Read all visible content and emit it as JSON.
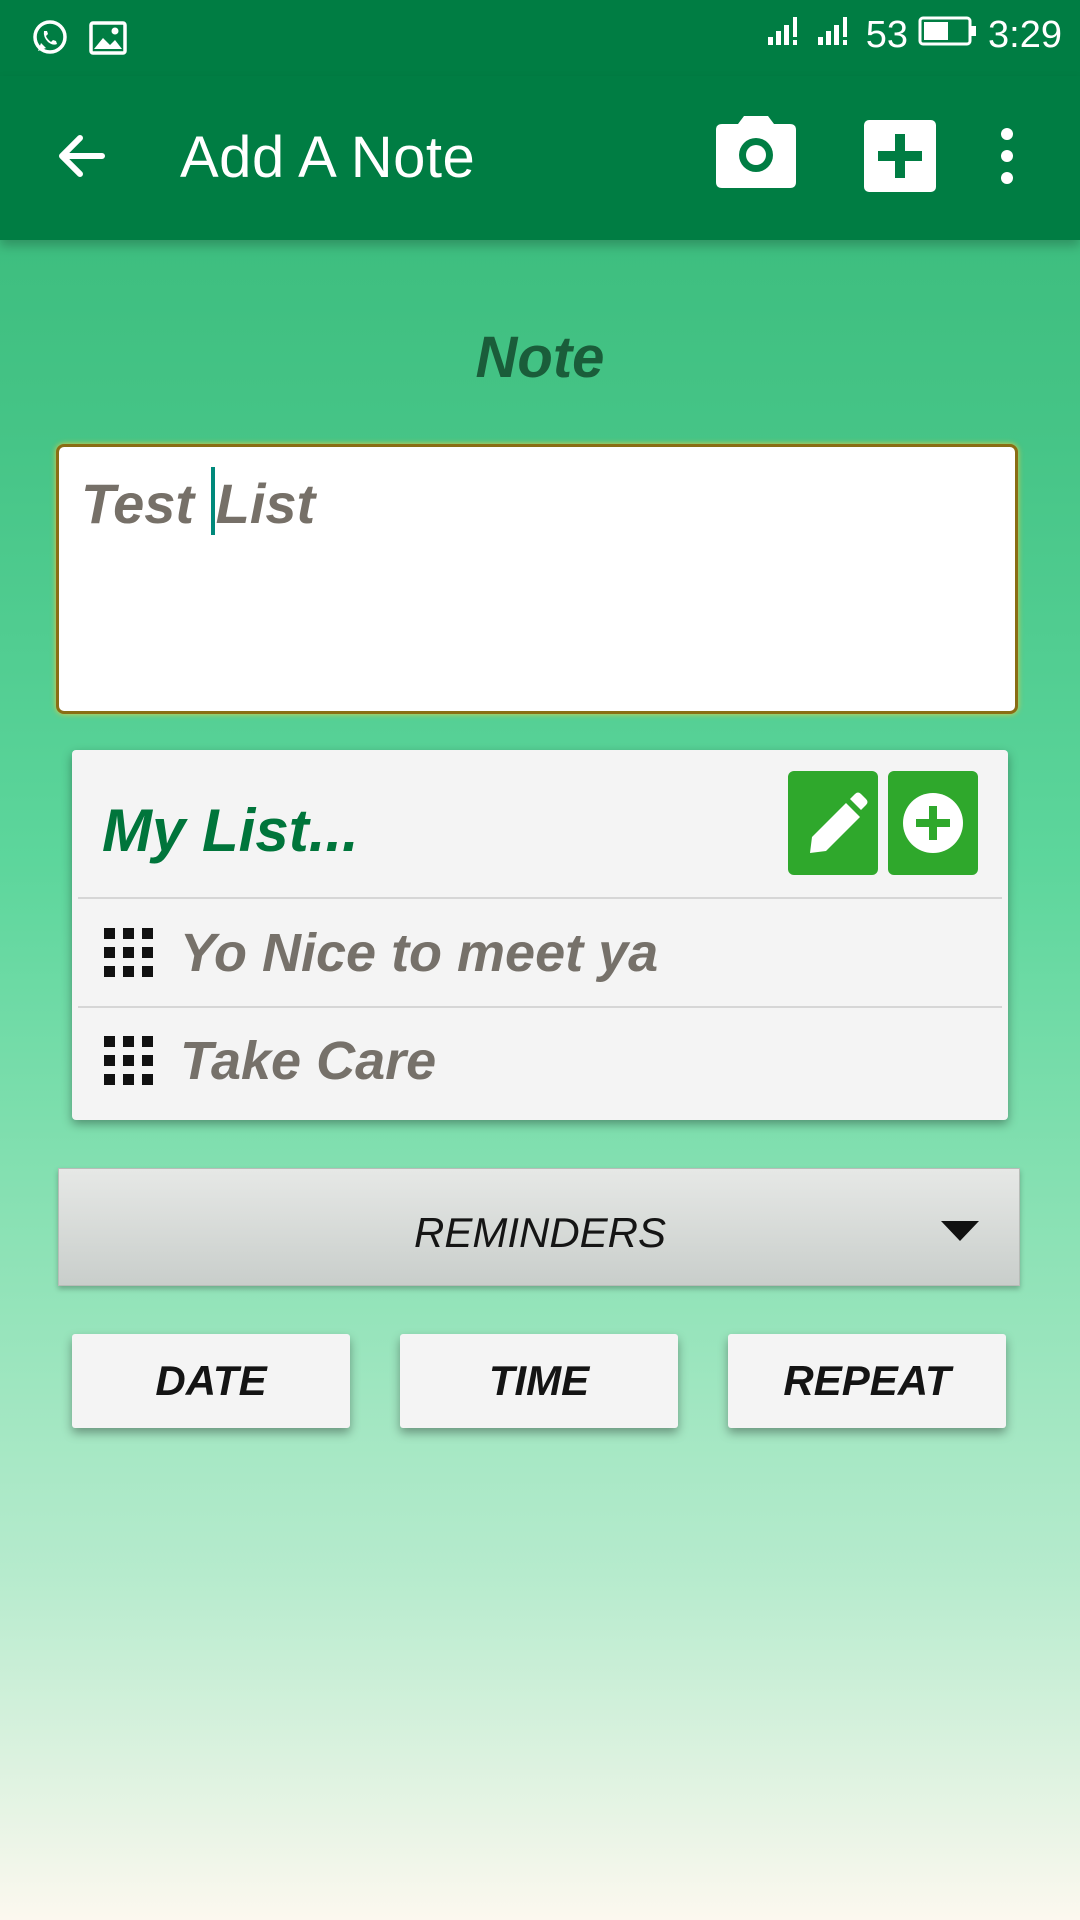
{
  "status_bar": {
    "icons": [
      "whatsapp-icon",
      "image-icon",
      "signal-icon",
      "signal-icon",
      "battery-icon"
    ],
    "battery": "53",
    "time": "3:29"
  },
  "app_bar": {
    "title": "Add A Note",
    "actions": [
      "back-arrow-icon",
      "camera-icon",
      "add-box-icon",
      "more-vert-icon"
    ]
  },
  "note": {
    "heading": "Note",
    "text_before_cursor": "Test ",
    "text_after_cursor": "List"
  },
  "list": {
    "title": "My List...",
    "actions": [
      "pencil-icon",
      "add-circle-icon"
    ],
    "items": [
      {
        "icon": "grid-icon",
        "label": "Yo Nice to meet ya"
      },
      {
        "icon": "grid-icon",
        "label": "Take Care"
      }
    ]
  },
  "reminders": {
    "label": "REMINDERS",
    "icon": "caret-down-icon"
  },
  "buttons": {
    "date": "DATE",
    "time": "TIME",
    "repeat": "REPEAT"
  },
  "colors": {
    "app_bar": "#007d43",
    "accent_green": "#2fa82c",
    "list_title": "#00753b",
    "note_border": "#8a6d14"
  }
}
